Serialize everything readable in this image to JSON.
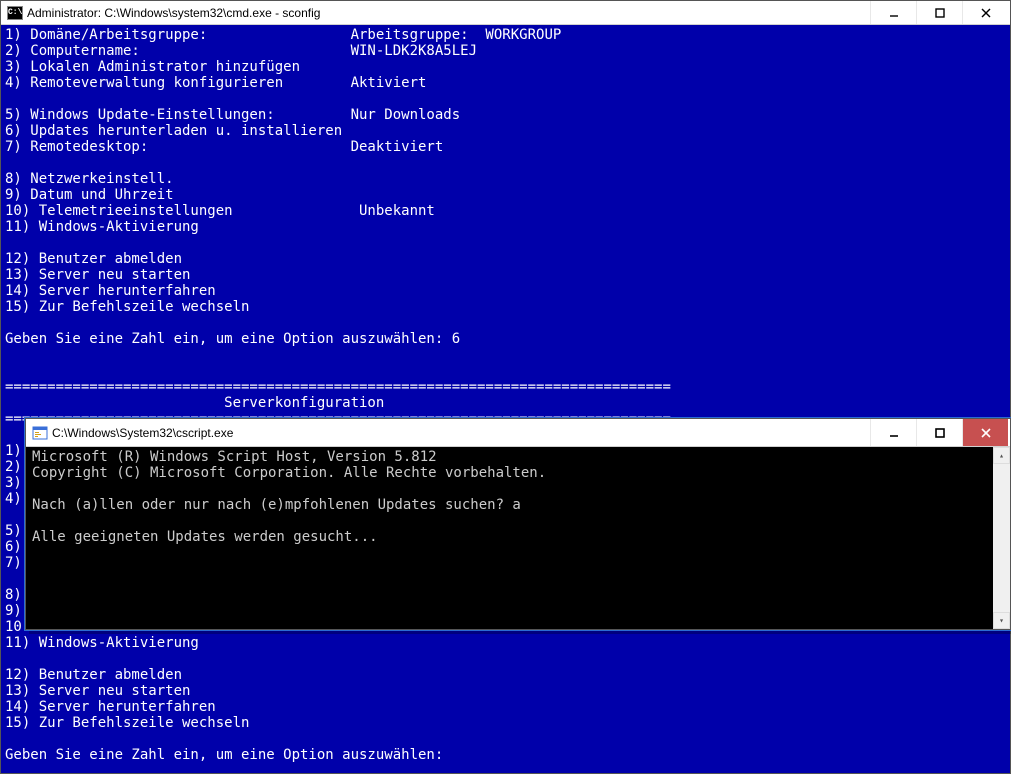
{
  "main": {
    "title": "Administrator: C:\\Windows\\system32\\cmd.exe - sconfig",
    "lines": [
      "1) Domäne/Arbeitsgruppe:                 Arbeitsgruppe:  WORKGROUP",
      "2) Computername:                         WIN-LDK2K8A5LEJ",
      "3) Lokalen Administrator hinzufügen",
      "4) Remoteverwaltung konfigurieren        Aktiviert",
      "",
      "5) Windows Update-Einstellungen:         Nur Downloads",
      "6) Updates herunterladen u. installieren",
      "7) Remotedesktop:                        Deaktiviert",
      "",
      "8) Netzwerkeinstell.",
      "9) Datum und Uhrzeit",
      "10) Telemetrieeinstellungen               Unbekannt",
      "11) Windows-Aktivierung",
      "",
      "12) Benutzer abmelden",
      "13) Server neu starten",
      "14) Server herunterfahren",
      "15) Zur Befehlszeile wechseln",
      "",
      "Geben Sie eine Zahl ein, um eine Option auszuwählen: 6",
      "",
      "",
      "===============================================================================",
      "                          Serverkonfiguration",
      "===============================================================================",
      "",
      "1)",
      "2)",
      "3)",
      "4)",
      "",
      "5)",
      "6)",
      "7)",
      "",
      "8)",
      "9)",
      "10",
      "11) Windows-Aktivierung",
      "",
      "12) Benutzer abmelden",
      "13) Server neu starten",
      "14) Server herunterfahren",
      "15) Zur Befehlszeile wechseln",
      "",
      "Geben Sie eine Zahl ein, um eine Option auszuwählen:"
    ]
  },
  "inner": {
    "title": "C:\\Windows\\System32\\cscript.exe",
    "lines": [
      "Microsoft (R) Windows Script Host, Version 5.812",
      "Copyright (C) Microsoft Corporation. Alle Rechte vorbehalten.",
      "",
      "Nach (a)llen oder nur nach (e)mpfohlenen Updates suchen? a",
      "",
      "Alle geeigneten Updates werden gesucht..."
    ]
  }
}
